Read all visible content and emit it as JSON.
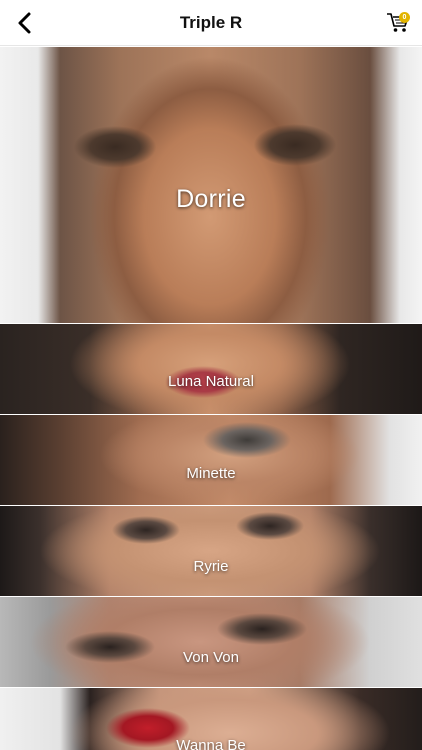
{
  "header": {
    "title": "Triple R",
    "back_icon": "chevron-left-icon",
    "cart_icon": "shopping-cart-icon",
    "cart_badge": "0"
  },
  "colors": {
    "header_bg": "#ffffff",
    "title_text": "#111111",
    "label_text": "#ffffff",
    "cart_badge": "#e2b400"
  },
  "products": [
    {
      "name": "Dorrie"
    },
    {
      "name": "Luna Natural"
    },
    {
      "name": "Minette"
    },
    {
      "name": "Ryrie"
    },
    {
      "name": "Von Von"
    },
    {
      "name": "Wanna Be"
    }
  ]
}
